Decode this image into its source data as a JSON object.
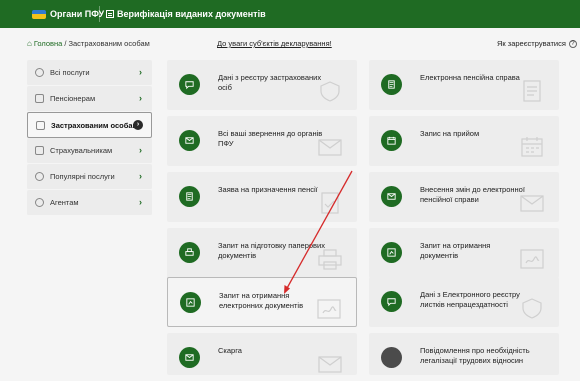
{
  "topbar": {
    "item1_label": "Органи ПФУ",
    "item2_label": "Верифікація виданих документів",
    "accent": "#1f6b23"
  },
  "breadcrumb": {
    "home": "Головна",
    "current": "Застрахованим особам"
  },
  "notice_link": "До уваги суб'єктів декларування!",
  "register_link": "Як зареєструватися",
  "sidebar": {
    "items": [
      {
        "label": "Всі послуги",
        "icon": "circle-icon"
      },
      {
        "label": "Пенсіонерам",
        "icon": "envelope-icon"
      },
      {
        "label": "Застрахованим особам",
        "icon": "document-icon",
        "active": true
      },
      {
        "label": "Страхувальникам",
        "icon": "document-icon"
      },
      {
        "label": "Популярні послуги",
        "icon": "circle-icon"
      },
      {
        "label": "Агентам",
        "icon": "gear-icon"
      }
    ]
  },
  "cards": {
    "left": [
      {
        "title": "Дані з реєстру застрахованих осіб",
        "icon": "chat-icon"
      },
      {
        "title": "Всі ваші звернення до органів ПФУ",
        "icon": "envelope-icon"
      },
      {
        "title": "Заява на призначення пенсії",
        "icon": "document-icon"
      },
      {
        "title": "Запит на підготовку паперових документів",
        "icon": "printer-icon"
      },
      {
        "title": "Запит на отримання електронних документів",
        "icon": "signed-document-icon",
        "selected": true
      },
      {
        "title": "Скарга",
        "icon": "envelope-icon"
      }
    ],
    "right": [
      {
        "title": "Електронна пенсійна справа",
        "icon": "document-icon"
      },
      {
        "title": "Запис на прийом",
        "icon": "calendar-icon"
      },
      {
        "title": "Внесення змін до електронної пенсійної справи",
        "icon": "envelope-icon"
      },
      {
        "title": "Запит на отримання документів",
        "icon": "signed-document-icon"
      },
      {
        "title": "Дані з Електронного реєстру листків непрацездатності",
        "icon": "chat-icon"
      },
      {
        "title": "Повідомлення про необхідність легалізації трудових відносин",
        "icon": "dot-icon"
      }
    ]
  },
  "annotation": {
    "arrow_color": "#d62b2b"
  }
}
